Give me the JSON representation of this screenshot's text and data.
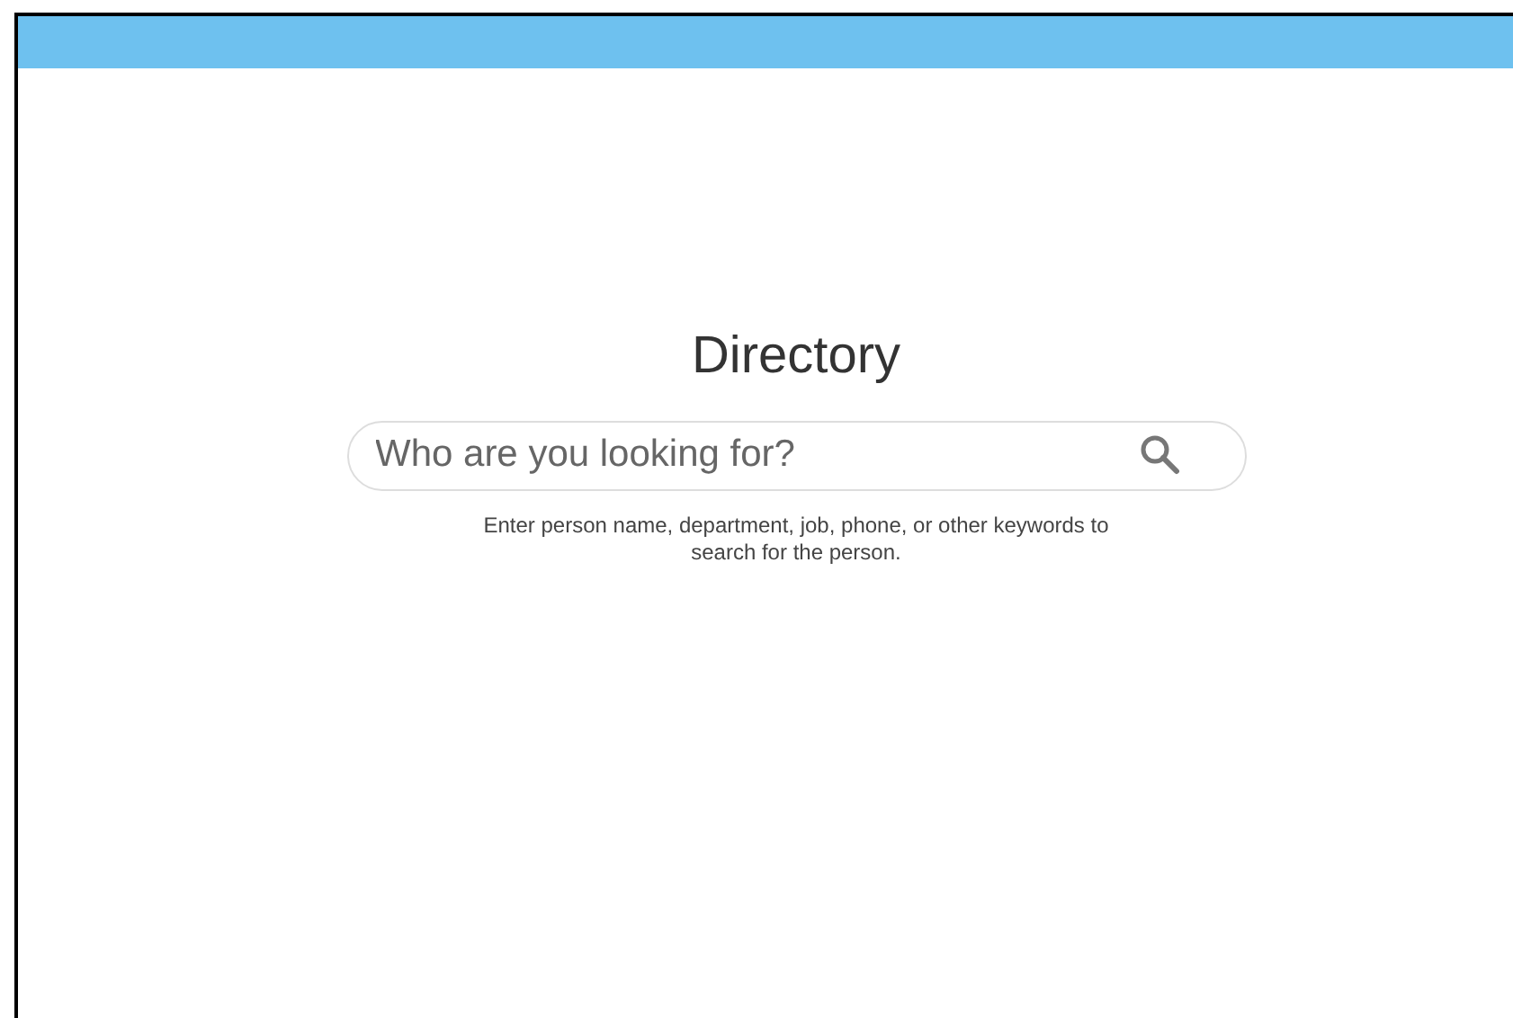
{
  "title": "Directory",
  "search": {
    "placeholder": "Who are you looking for?"
  },
  "help_text": "Enter person name, department, job, phone, or other keywords to search for the person."
}
